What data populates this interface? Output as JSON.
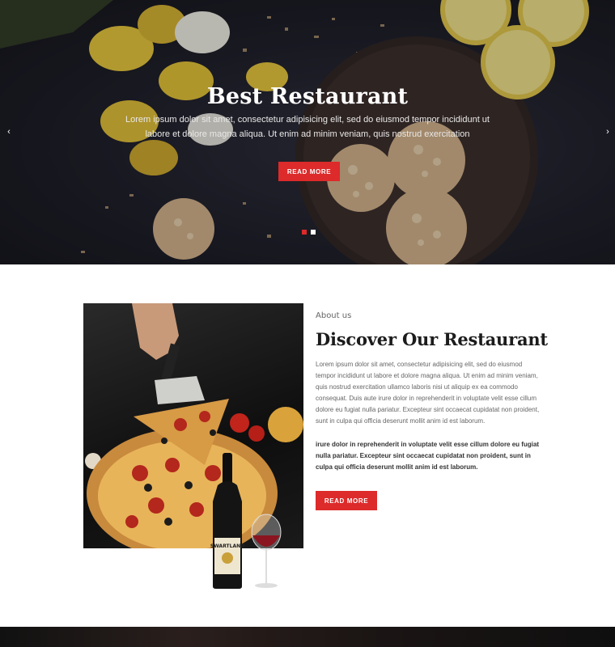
{
  "hero": {
    "title": "Best Restaurant",
    "text": "Lorem ipsum dolor sit amet, consectetur adipisicing elit, sed do eiusmod tempor incididunt ut labore et dolore magna aliqua. Ut enim ad minim veniam, quis nostrud exercitation",
    "button_label": "READ MORE",
    "prev_arrow": "‹",
    "next_arrow": "›",
    "slides_total": 2,
    "active_slide": 1
  },
  "about": {
    "kicker": "About us",
    "title": "Discover Our Restaurant",
    "paragraph": "Lorem ipsum dolor sit amet, consectetur adipisicing elit, sed do eiusmod tempor incididunt ut labore et dolore magna aliqua. Ut enim ad minim veniam, quis nostrud exercitation ullamco laboris nisi ut aliquip ex ea commodo consequat. Duis aute irure dolor in reprehenderit in voluptate velit esse cillum dolore eu fugiat nulla pariatur. Excepteur sint occaecat cupidatat non proident, sunt in culpa qui officia deserunt mollit anim id est laborum.",
    "bold_paragraph": "irure dolor in reprehenderit in voluptate velit esse cillum dolore eu fugiat nulla pariatur. Excepteur sint occaecat cupidatat non proident, sunt in culpa qui officia deserunt mollit anim id est laborum.",
    "button_label": "READ MORE",
    "wine_label": "SWARTLAND"
  },
  "colors": {
    "accent": "#dd2a2a",
    "hero_bg": "#1c1c26",
    "heading": "#1c1c1c"
  }
}
